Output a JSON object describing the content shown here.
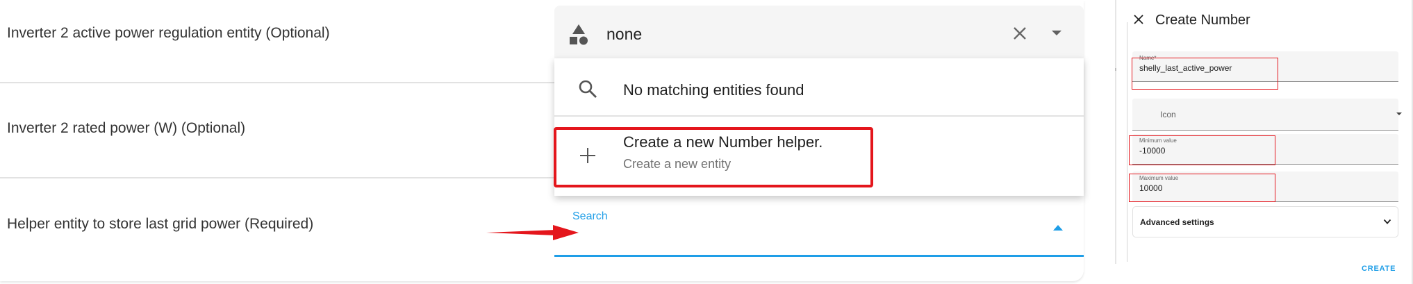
{
  "form": {
    "rows": [
      {
        "label": "Inverter 2 active power regulation entity (Optional)"
      },
      {
        "label": "Inverter 2 rated power (W) (Optional)"
      },
      {
        "label": "Helper entity to store last grid power (Required)"
      }
    ],
    "combo": {
      "value": "none",
      "icon": "shapes-icon"
    },
    "dropdown": {
      "empty_text": "No matching entities found",
      "create_primary": "Create a new Number helper.",
      "create_secondary": "Create a new entity"
    },
    "search": {
      "label": "Search",
      "value": ""
    }
  },
  "dialog": {
    "title": "Create Number",
    "fields": {
      "name": {
        "label": "Name*",
        "value": "shelly_last_active_power"
      },
      "icon": {
        "placeholder": "Icon"
      },
      "min": {
        "label": "Minimum value",
        "value": "-10000"
      },
      "max": {
        "label": "Maximum value",
        "value": "10000"
      }
    },
    "advanced_label": "Advanced settings",
    "create_label": "CREATE"
  },
  "colors": {
    "accent": "#1f9ee7",
    "highlight": "#e4161c",
    "field_bg": "#f5f5f5"
  }
}
